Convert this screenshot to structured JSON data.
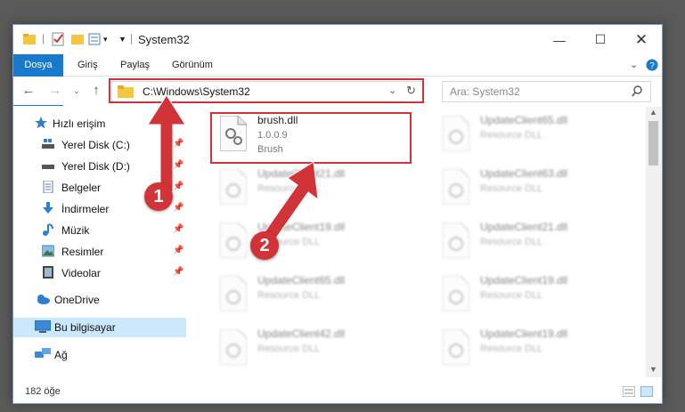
{
  "window": {
    "title": "System32"
  },
  "ribbon": {
    "tabs": [
      "Dosya",
      "Giriş",
      "Paylaş",
      "Görünüm"
    ]
  },
  "address": {
    "path": "C:\\Windows\\System32"
  },
  "search": {
    "placeholder": "Ara: System32"
  },
  "sidebar": {
    "items": [
      {
        "label": "Hızlı erişim",
        "icon": "star-icon"
      },
      {
        "label": "Yerel Disk (C:)",
        "icon": "drive-icon"
      },
      {
        "label": "Yerel Disk (D:)",
        "icon": "drive-icon"
      },
      {
        "label": "Belgeler",
        "icon": "documents-icon"
      },
      {
        "label": "İndirmeler",
        "icon": "download-icon"
      },
      {
        "label": "Müzik",
        "icon": "music-icon"
      },
      {
        "label": "Resimler",
        "icon": "pictures-icon"
      },
      {
        "label": "Videolar",
        "icon": "video-icon"
      },
      {
        "label": "OneDrive",
        "icon": "cloud-icon"
      },
      {
        "label": "Bu bilgisayar",
        "icon": "computer-icon"
      },
      {
        "label": "Ağ",
        "icon": "network-icon"
      }
    ]
  },
  "files": [
    {
      "name": "brush.dll",
      "version": "1.0.0.9",
      "desc": "Brush"
    },
    {
      "name": "UpdateClient65.dll",
      "desc": "Resource DLL"
    },
    {
      "name": "UpdateClient21.dll",
      "desc": "Resource DLL"
    },
    {
      "name": "UpdateClient63.dll",
      "desc": "Resource DLL"
    },
    {
      "name": "UpdateClient19.dll",
      "desc": "Resource DLL"
    },
    {
      "name": "UpdateClient21.dll",
      "desc": "Resource DLL"
    },
    {
      "name": "UpdateClient65.dll",
      "desc": "Resource DLL"
    },
    {
      "name": "UpdateClient19.dll",
      "desc": "Resource DLL"
    },
    {
      "name": "UpdateClient42.dll",
      "desc": "Resource DLL"
    },
    {
      "name": "UpdateClient19.dll",
      "desc": "Resource DLL"
    }
  ],
  "status": {
    "count": "182 öğe"
  },
  "callouts": [
    "1",
    "2"
  ],
  "colors": {
    "accent": "#1979ca",
    "highlight": "#d13438",
    "selected": "#cce8ff"
  }
}
